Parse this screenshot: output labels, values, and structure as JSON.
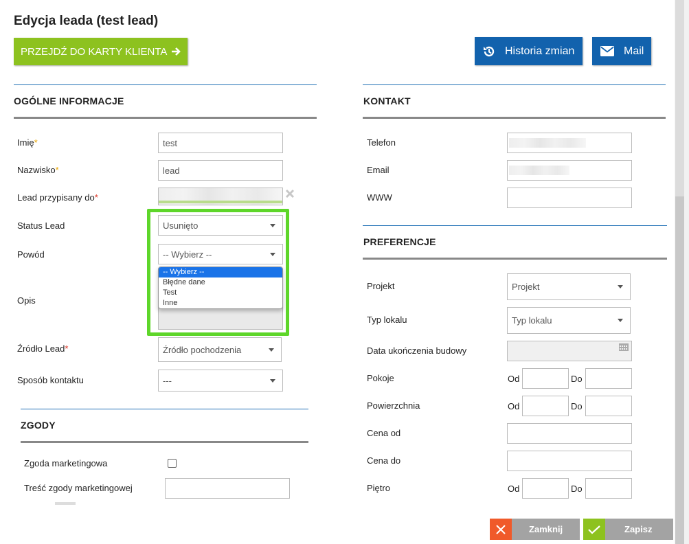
{
  "title": "Edycja leada (test lead)",
  "buttons": {
    "card": "PRZEJDŹ DO KARTY KLIENTA",
    "history": "Historia zmian",
    "mail": "Mail",
    "close": "Zamknij",
    "save": "Zapisz"
  },
  "general": {
    "title": "OGÓLNE INFORMACJE",
    "first_name_label": "Imię",
    "first_name_value": "test",
    "last_name_label": "Nazwisko",
    "last_name_value": "lead",
    "assigned_label": "Lead przypisany do",
    "status_label": "Status Lead",
    "status_value": "Usunięto",
    "reason_label": "Powód",
    "reason_value": "-- Wybierz --",
    "reason_options": [
      "-- Wybierz --",
      "Błędne dane",
      "Test",
      "Inne"
    ],
    "desc_label": "Opis",
    "source_label": "Źródło Lead",
    "source_value": "Źródło pochodzenia",
    "contact_method_label": "Sposób kontaktu",
    "contact_method_value": "---"
  },
  "consents": {
    "title": "ZGODY",
    "marketing_label": "Zgoda marketingowa",
    "marketing_text_label": "Treść zgody marketingowej"
  },
  "contact": {
    "title": "KONTAKT",
    "phone_label": "Telefon",
    "email_label": "Email",
    "www_label": "WWW"
  },
  "preferences": {
    "title": "PREFERENCJE",
    "project_label": "Projekt",
    "project_value": "Projekt",
    "unit_type_label": "Typ lokalu",
    "unit_type_value": "Typ lokalu",
    "completion_label": "Data ukończenia budowy",
    "rooms_label": "Pokoje",
    "area_label": "Powierzchnia",
    "price_from_label": "Cena od",
    "price_to_label": "Cena do",
    "floor_label": "Piętro",
    "from": "Od",
    "to": "Do"
  },
  "colors": {
    "accent_green": "#8dc21f",
    "accent_blue": "#1262ad",
    "highlight": "#5ed62a",
    "close_red": "#f05a2a"
  }
}
